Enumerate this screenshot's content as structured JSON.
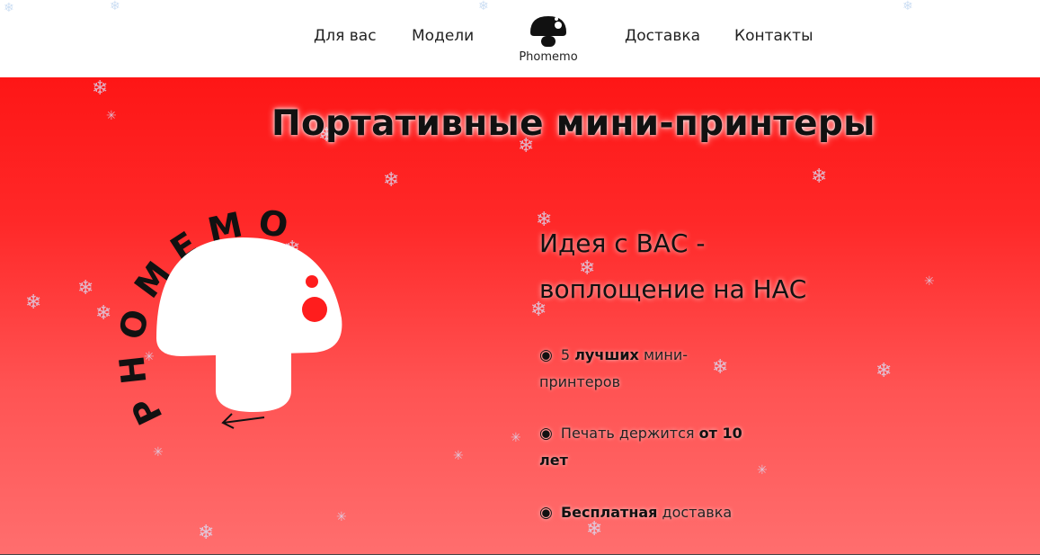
{
  "nav": {
    "items": [
      "Для вас",
      "Модели",
      "Доставка",
      "Контакты"
    ],
    "logo_text": "Phomemo"
  },
  "hero": {
    "title": "Портативные мини-принтеры",
    "circular_text": "PHOMEMO",
    "tagline_line1": "Идея с ВАС -",
    "tagline_line2": "воплощение на НАС",
    "features": [
      {
        "bullet": "◉",
        "pre": " 5 ",
        "bold": "лучших",
        "post": " мини-принтеров",
        "bold2": ""
      },
      {
        "bullet": "◉",
        "pre": " Печать держится ",
        "bold": "от 10 лет",
        "post": "",
        "bold2": ""
      },
      {
        "bullet": "◉",
        "pre": " ",
        "bold": "Бесплатная",
        "post": " доставка",
        "bold2": ""
      }
    ]
  },
  "colors": {
    "hero_top": "#fe1616",
    "hero_bottom": "#ff6e6e",
    "text": "#111111"
  },
  "icons": {
    "logo": "mushroom-icon",
    "snow": "snowflake-icon",
    "arrow": "arrow-left-icon"
  }
}
